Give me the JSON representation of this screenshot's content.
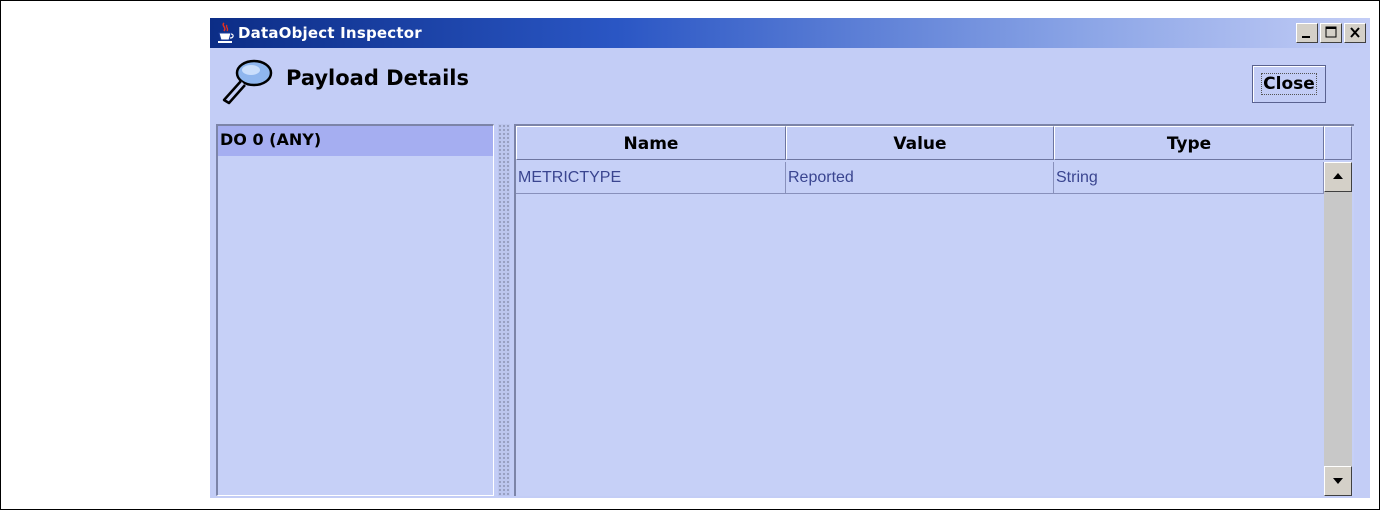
{
  "window": {
    "title": "DataObject Inspector",
    "icons": {
      "app": "java-cup-icon",
      "minimize": "minimize-icon",
      "maximize": "maximize-icon",
      "close": "close-icon"
    }
  },
  "header": {
    "title": "Payload Details",
    "icon": "magnifier-icon",
    "close_label": "Close"
  },
  "tree": {
    "items": [
      {
        "label": "DO 0 (ANY)",
        "selected": true
      }
    ]
  },
  "table": {
    "columns": [
      "Name",
      "Value",
      "Type"
    ],
    "rows": [
      [
        "METRICTYPE",
        "Reported",
        "String"
      ]
    ]
  },
  "colors": {
    "panel_bg": "#c3cdf6",
    "selected_item": "#a5aef1",
    "title_gradient_start": "#0c2d86",
    "cell_text": "#3a4590"
  }
}
